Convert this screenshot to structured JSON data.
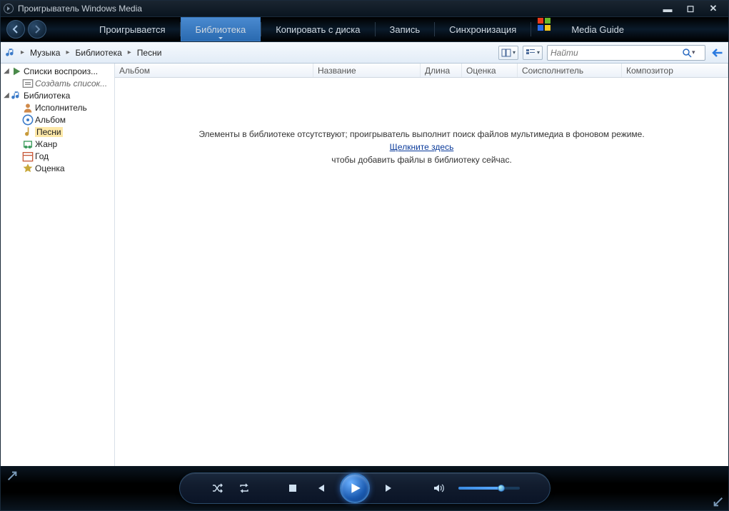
{
  "titlebar": {
    "title": "Проигрыватель Windows Media"
  },
  "topnav": {
    "now_playing": "Проигрывается",
    "library": "Библиотека",
    "rip": "Копировать с диска",
    "burn": "Запись",
    "sync": "Синхронизация",
    "media_guide": "Media Guide"
  },
  "breadcrumb": {
    "root": "Музыка",
    "lib": "Библиотека",
    "songs": "Песни"
  },
  "search": {
    "placeholder": "Найти"
  },
  "tree": {
    "playlists": "Списки воспроиз...",
    "create_playlist": "Создать список...",
    "library": "Библиотека",
    "artist": "Исполнитель",
    "album": "Альбом",
    "songs": "Песни",
    "genre": "Жанр",
    "year": "Год",
    "rating": "Оценка"
  },
  "columns": {
    "album": "Альбом",
    "title": "Название",
    "length": "Длина",
    "rating": "Оценка",
    "contributing": "Соисполнитель",
    "composer": "Композитор"
  },
  "empty": {
    "line1": "Элементы в библиотеке отсутствуют; проигрыватель выполнит поиск файлов мультимедиа в фоновом режиме.",
    "link": "Щелкните здесь",
    "line2": "чтобы добавить файлы в библиотеку сейчас."
  }
}
